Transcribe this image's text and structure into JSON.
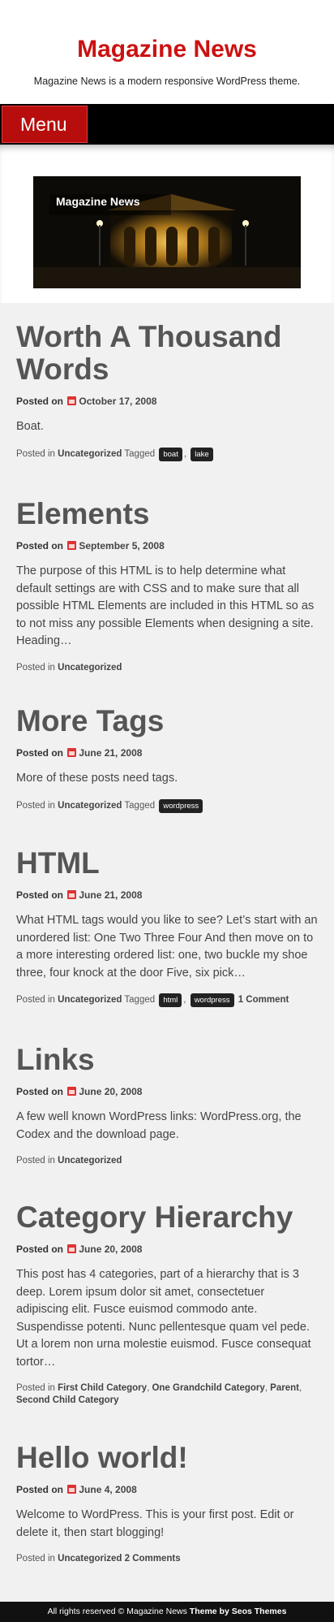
{
  "site": {
    "title": "Magazine News",
    "description": "Magazine News is a modern responsive WordPress theme."
  },
  "menu": {
    "label": "Menu"
  },
  "banner": {
    "title": "Magazine News"
  },
  "posted_on_label": "Posted on",
  "posted_in_label": "Posted in",
  "tagged_label": "Tagged",
  "posts": [
    {
      "title_lines": [
        "Worth A Thousand",
        "Words"
      ],
      "date": "October 17, 2008",
      "excerpt": [
        "Boat."
      ],
      "categories": [
        "Uncategorized"
      ],
      "tags": [
        "boat",
        "lake"
      ],
      "comments": ""
    },
    {
      "title_lines": [
        "Elements"
      ],
      "date": "September 5, 2008",
      "excerpt": [
        "The purpose of this HTML is to help determine what",
        "default settings are with CSS and to make sure that all",
        "possible HTML Elements are included in this HTML so as",
        "to not miss any possible Elements when designing a site.",
        "Heading…"
      ],
      "categories": [
        "Uncategorized"
      ],
      "tags": [],
      "comments": ""
    },
    {
      "title_lines": [
        "More Tags"
      ],
      "date": "June 21, 2008",
      "excerpt": [
        "More of these posts need tags."
      ],
      "categories": [
        "Uncategorized"
      ],
      "tags": [
        "wordpress"
      ],
      "comments": ""
    },
    {
      "title_lines": [
        "HTML"
      ],
      "date": "June 21, 2008",
      "excerpt": [
        "What HTML tags would you like to see? Let’s start with an",
        "unordered list: One Two Three Four And then move on to",
        "a more interesting ordered list: one, two buckle my shoe",
        "three, four knock at the door Five, six pick…"
      ],
      "categories": [
        "Uncategorized"
      ],
      "tags": [
        "html",
        "wordpress"
      ],
      "comments": "1 Comment"
    },
    {
      "title_lines": [
        "Links"
      ],
      "date": "June 20, 2008",
      "excerpt": [
        "A few well known WordPress links: WordPress.org, the",
        "Codex and the download page."
      ],
      "categories": [
        "Uncategorized"
      ],
      "tags": [],
      "comments": ""
    },
    {
      "title_lines": [
        "Category Hierarchy"
      ],
      "date": "June 20, 2008",
      "excerpt": [
        "This post has 4 categories, part of a hierarchy that is 3",
        "deep. Lorem ipsum dolor sit amet, consectetuer",
        "adipiscing elit. Fusce euismod commodo ante.",
        "Suspendisse potenti. Nunc pellentesque quam vel pede.",
        "Ut a lorem non urna molestie euismod. Fusce consequat",
        "tortor…"
      ],
      "categories": [
        "First Child Category",
        "One Grandchild Category",
        "Parent",
        "Second Child Category"
      ],
      "tags": [],
      "comments": ""
    },
    {
      "title_lines": [
        "Hello world!"
      ],
      "date": "June 4, 2008",
      "excerpt": [
        "Welcome to WordPress. This is your first post. Edit or",
        "delete it, then start blogging!"
      ],
      "categories": [
        "Uncategorized"
      ],
      "tags": [],
      "comments": "2 Comments"
    }
  ],
  "footer": {
    "text": "All rights reserved © Magazine News",
    "credit": "Theme by Seos Themes"
  }
}
